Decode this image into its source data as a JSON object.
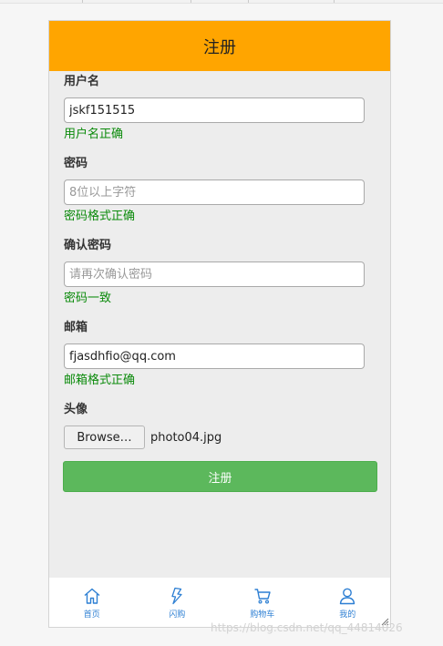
{
  "page": {
    "title": "注册"
  },
  "form": {
    "username": {
      "label": "用户名",
      "value": "jskf151515",
      "hint": "用户名正确"
    },
    "password": {
      "label": "密码",
      "placeholder": "8位以上字符",
      "hint": "密码格式正确"
    },
    "confirm_password": {
      "label": "确认密码",
      "placeholder": "请再次确认密码",
      "hint": "密码一致"
    },
    "email": {
      "label": "邮箱",
      "value": "fjasdhfio@qq.com",
      "hint": "邮箱格式正确"
    },
    "avatar": {
      "label": "头像",
      "browse_label": "Browse…",
      "file_name": "photo04.jpg"
    },
    "submit_label": "注册"
  },
  "tabbar": {
    "items": [
      {
        "label": "首页",
        "icon": "home-icon"
      },
      {
        "label": "闪购",
        "icon": "flash-icon"
      },
      {
        "label": "购物车",
        "icon": "cart-icon"
      },
      {
        "label": "我的",
        "icon": "user-icon"
      }
    ]
  },
  "watermark": "https://blog.csdn.net/qq_44814026",
  "colors": {
    "header": "#ffa500",
    "submit": "#5cb85c",
    "hint": "#0a8a0a",
    "tab": "#2d7fd3"
  }
}
